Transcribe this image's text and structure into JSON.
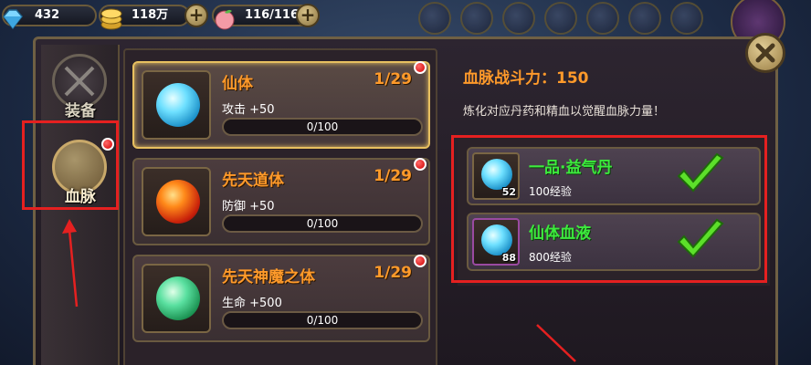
{
  "resources": {
    "diamonds": "432",
    "gold": "118万",
    "stamina": "116/116"
  },
  "sidebar": {
    "tabs": [
      {
        "label": "装备"
      },
      {
        "label": "血脉"
      }
    ]
  },
  "bloodlines": [
    {
      "name": "仙体",
      "level": "1/29",
      "stat": "攻击 +50",
      "progress_text": "0/100",
      "progress": 0
    },
    {
      "name": "先天道体",
      "level": "1/29",
      "stat": "防御 +50",
      "progress_text": "0/100",
      "progress": 0
    },
    {
      "name": "先天神魔之体",
      "level": "1/29",
      "stat": "生命 +500",
      "progress_text": "0/100",
      "progress": 0
    }
  ],
  "detail": {
    "power": "血脉战斗力：150",
    "description": "炼化对应丹药和精血以觉醒血脉力量！"
  },
  "materials": [
    {
      "name": "一品·益气丹",
      "exp": "100经验",
      "count": "52",
      "icon": "blue-orb-scroll-icon"
    },
    {
      "name": "仙体血液",
      "exp": "800经验",
      "count": "88",
      "icon": "blue-orb-purple-icon"
    }
  ],
  "colors": {
    "title_orange": "#ff9a2a",
    "material_green": "#3dea3d",
    "highlight_red": "#e52020"
  }
}
